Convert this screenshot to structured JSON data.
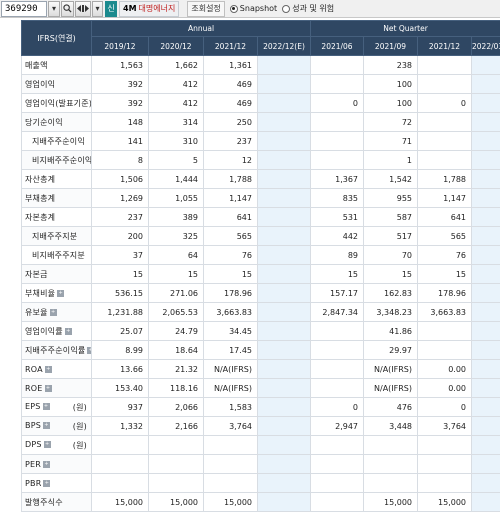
{
  "toolbar": {
    "code": "369290",
    "search_icon": "magnifier-icon",
    "nav_icon": "arrows-icon",
    "badge": "신",
    "market": "4M",
    "company": "대명에너지",
    "settings": "조회설정",
    "views": [
      {
        "label": "Snapshot",
        "selected": true
      },
      {
        "label": "성과 및 위험",
        "selected": false
      }
    ]
  },
  "table": {
    "corner": "IFRS(연결)",
    "groups": [
      "Annual",
      "Net Quarter"
    ],
    "periods": [
      "2019/12",
      "2020/12",
      "2021/12",
      "2022/12(E)",
      "2021/06",
      "2021/09",
      "2021/12",
      "2022/03(E)"
    ],
    "rows": [
      {
        "label": "매출액",
        "unit": "",
        "info": false,
        "sub": false,
        "values": [
          "1,563",
          "1,662",
          "1,361",
          "",
          "",
          "238",
          "",
          ""
        ]
      },
      {
        "label": "영업이익",
        "unit": "",
        "info": false,
        "sub": false,
        "values": [
          "392",
          "412",
          "469",
          "",
          "",
          "100",
          "",
          ""
        ]
      },
      {
        "label": "영업이익(발표기준)",
        "unit": "",
        "info": false,
        "sub": false,
        "values": [
          "392",
          "412",
          "469",
          "",
          "0",
          "100",
          "0",
          ""
        ]
      },
      {
        "label": "당기순이익",
        "unit": "",
        "info": false,
        "sub": false,
        "values": [
          "148",
          "314",
          "250",
          "",
          "",
          "72",
          "",
          ""
        ]
      },
      {
        "label": "지배주주순이익",
        "unit": "",
        "info": false,
        "sub": true,
        "values": [
          "141",
          "310",
          "237",
          "",
          "",
          "71",
          "",
          ""
        ]
      },
      {
        "label": "비지배주주순이익",
        "unit": "",
        "info": false,
        "sub": true,
        "values": [
          "8",
          "5",
          "12",
          "",
          "",
          "1",
          "",
          ""
        ]
      },
      {
        "label": "자산총계",
        "unit": "",
        "info": false,
        "sub": false,
        "values": [
          "1,506",
          "1,444",
          "1,788",
          "",
          "1,367",
          "1,542",
          "1,788",
          ""
        ]
      },
      {
        "label": "부채총계",
        "unit": "",
        "info": false,
        "sub": false,
        "values": [
          "1,269",
          "1,055",
          "1,147",
          "",
          "835",
          "955",
          "1,147",
          ""
        ]
      },
      {
        "label": "자본총계",
        "unit": "",
        "info": false,
        "sub": false,
        "values": [
          "237",
          "389",
          "641",
          "",
          "531",
          "587",
          "641",
          ""
        ]
      },
      {
        "label": "지배주주지분",
        "unit": "",
        "info": false,
        "sub": true,
        "values": [
          "200",
          "325",
          "565",
          "",
          "442",
          "517",
          "565",
          ""
        ]
      },
      {
        "label": "비지배주주지분",
        "unit": "",
        "info": false,
        "sub": true,
        "values": [
          "37",
          "64",
          "76",
          "",
          "89",
          "70",
          "76",
          ""
        ]
      },
      {
        "label": "자본금",
        "unit": "",
        "info": false,
        "sub": false,
        "values": [
          "15",
          "15",
          "15",
          "",
          "15",
          "15",
          "15",
          ""
        ]
      },
      {
        "label": "부채비율",
        "unit": "",
        "info": true,
        "sub": false,
        "values": [
          "536.15",
          "271.06",
          "178.96",
          "",
          "157.17",
          "162.83",
          "178.96",
          ""
        ]
      },
      {
        "label": "유보율",
        "unit": "",
        "info": true,
        "sub": false,
        "values": [
          "1,231.88",
          "2,065.53",
          "3,663.83",
          "",
          "2,847.34",
          "3,348.23",
          "3,663.83",
          ""
        ]
      },
      {
        "label": "영업이익률",
        "unit": "",
        "info": true,
        "sub": false,
        "values": [
          "25.07",
          "24.79",
          "34.45",
          "",
          "",
          "41.86",
          "",
          ""
        ]
      },
      {
        "label": "지배주주순이익률",
        "unit": "",
        "info": true,
        "sub": false,
        "values": [
          "8.99",
          "18.64",
          "17.45",
          "",
          "",
          "29.97",
          "",
          ""
        ]
      },
      {
        "label": "ROA",
        "unit": "",
        "info": true,
        "sub": false,
        "values": [
          "13.66",
          "21.32",
          "N/A(IFRS)",
          "",
          "",
          "N/A(IFRS)",
          "0.00",
          ""
        ]
      },
      {
        "label": "ROE",
        "unit": "",
        "info": true,
        "sub": false,
        "values": [
          "153.40",
          "118.16",
          "N/A(IFRS)",
          "",
          "",
          "N/A(IFRS)",
          "0.00",
          ""
        ]
      },
      {
        "label": "EPS",
        "unit": "(원)",
        "info": true,
        "sub": false,
        "values": [
          "937",
          "2,066",
          "1,583",
          "",
          "0",
          "476",
          "0",
          ""
        ]
      },
      {
        "label": "BPS",
        "unit": "(원)",
        "info": true,
        "sub": false,
        "values": [
          "1,332",
          "2,166",
          "3,764",
          "",
          "2,947",
          "3,448",
          "3,764",
          ""
        ]
      },
      {
        "label": "DPS",
        "unit": "(원)",
        "info": true,
        "sub": false,
        "values": [
          "",
          "",
          "",
          "",
          "",
          "",
          "",
          ""
        ]
      },
      {
        "label": "PER",
        "unit": "",
        "info": true,
        "sub": false,
        "values": [
          "",
          "",
          "",
          "",
          "",
          "",
          "",
          ""
        ]
      },
      {
        "label": "PBR",
        "unit": "",
        "info": true,
        "sub": false,
        "values": [
          "",
          "",
          "",
          "",
          "",
          "",
          "",
          ""
        ]
      },
      {
        "label": "발행주식수",
        "unit": "",
        "info": false,
        "sub": false,
        "values": [
          "15,000",
          "15,000",
          "15,000",
          "",
          "",
          "15,000",
          "15,000",
          ""
        ]
      }
    ]
  }
}
